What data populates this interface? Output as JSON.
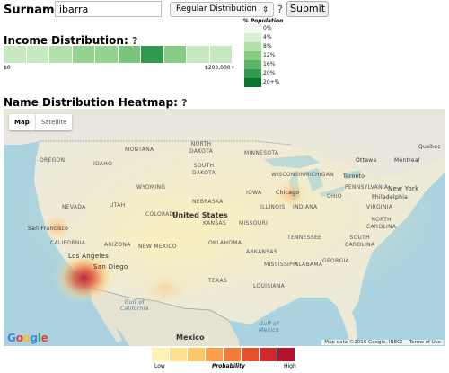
{
  "search": {
    "surname_label": "Surname:",
    "surname_value": "ibarra",
    "distribution_selected": "Regular Distribution",
    "help_mark": "?",
    "submit_label": "Submit"
  },
  "population_legend": {
    "title": "% Population",
    "labels": [
      "0%",
      "4%",
      "8%",
      "12%",
      "16%",
      "20%",
      "20+%"
    ],
    "colors": [
      "#f3faf1",
      "#d7efd2",
      "#b2e0ab",
      "#86cc82",
      "#5db368",
      "#2f9a4e",
      "#0a7532"
    ]
  },
  "income": {
    "heading": "Income Distribution:",
    "help_mark": "?",
    "min_label": "$0",
    "max_label": "$200,000+",
    "cell_colors": [
      "#c7e8c0",
      "#c7e8c0",
      "#b2e0ab",
      "#93d28f",
      "#93d28f",
      "#7bc47c",
      "#2f9a4e",
      "#86cc82",
      "#c7e8c0",
      "#c7e8c0"
    ]
  },
  "heatmap": {
    "heading": "Name Distribution Heatmap:",
    "help_mark": "?",
    "map_tab": "Map",
    "satellite_tab": "Satellite",
    "google_logo": "Google",
    "attribution": "Map data ©2016 Google, INEGI",
    "terms": "Terms of Use",
    "labels": {
      "north_dakota": "NORTH\nDAKOTA",
      "montana": "MONTANA",
      "minnesota": "MINNESOTA",
      "south_dakota": "SOUTH\nDAKOTA",
      "oregon": "OREGON",
      "idaho": "IDAHO",
      "wyoming": "WYOMING",
      "wisconsin": "WISCONSIN",
      "michigan": "MICHIGAN",
      "ottawa": "Ottawa",
      "montreal": "Montreal",
      "quebec": "Quebec",
      "toronto": "Toronto",
      "iowa": "IOWA",
      "nebraska": "NEBRASKA",
      "chicago": "Chicago",
      "ohio": "OHIO",
      "illinois": "ILLINOIS",
      "indiana": "INDIANA",
      "nevada": "NEVADA",
      "utah": "UTAH",
      "colorado": "COLORADO",
      "kansas": "KANSAS",
      "missouri": "MISSOURI",
      "united_states": "United States",
      "san_francisco": "San Francisco",
      "california": "CALIFORNIA",
      "arizona": "ARIZONA",
      "new_mexico": "NEW MEXICO",
      "oklahoma": "OKLAHOMA",
      "tennessee": "TENNESSEE",
      "arkansas": "ARKANSAS",
      "mississippi": "MISSISSIPPI",
      "alabama": "ALABAMA",
      "georgia": "GEORGIA",
      "south_carolina": "SOUTH\nCAROLINA",
      "north_carolina": "NORTH\nCAROLINA",
      "virginia": "VIRGINIA",
      "new_york": "New York",
      "philadelphia": "Philadelphia",
      "pennsylvania": "PENNSYLVANIA",
      "los_angeles": "Los Angeles",
      "san_diego": "San Diego",
      "texas": "TEXAS",
      "louisiana": "LOUISIANA",
      "gulf_of_california": "Gulf of\nCalifornia",
      "gulf_of_mexico": "Gulf of\nMexico",
      "mexico": "Mexico"
    }
  },
  "probability_legend": {
    "low": "Low",
    "title": "Probability",
    "high": "High",
    "colors": [
      "#fff2b5",
      "#fedf8e",
      "#fec56a",
      "#fd9f49",
      "#f47b37",
      "#e6512b",
      "#d02a28",
      "#b3122c"
    ]
  }
}
